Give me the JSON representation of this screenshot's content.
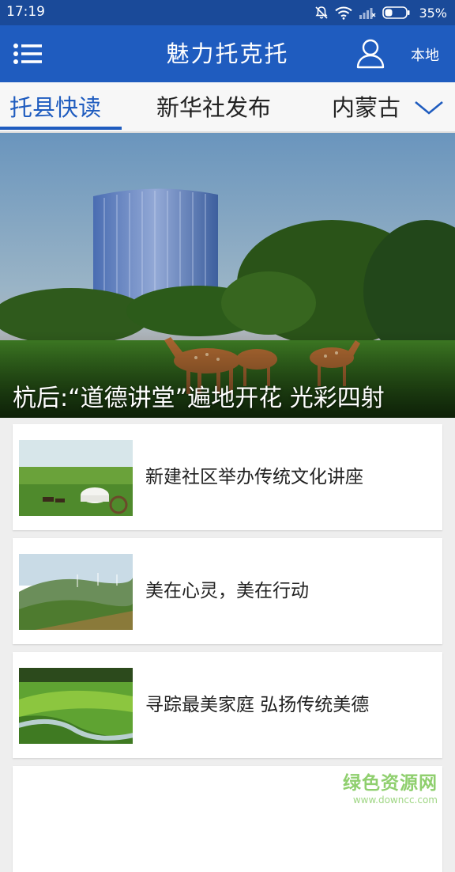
{
  "status_bar": {
    "time": "17:19",
    "battery": "35%"
  },
  "header": {
    "title": "魅力托克托",
    "local_label": "本地"
  },
  "tabs": [
    {
      "label": "托县快读",
      "active": true
    },
    {
      "label": "新华社发布",
      "active": false
    },
    {
      "label": "内蒙古",
      "active": false
    }
  ],
  "hero": {
    "caption": "杭后:“道德讲堂”遍地开花 光彩四射"
  },
  "news": [
    {
      "title": "新建社区举办传统文化讲座",
      "thumb": "grassland-yurt-horses"
    },
    {
      "title": "美在心灵，美在行动",
      "thumb": "hills-wind-turbines"
    },
    {
      "title": "寻踪最美家庭 弘扬传统美德",
      "thumb": "river-wetland"
    },
    {
      "title": "",
      "thumb": ""
    }
  ],
  "watermark": {
    "main": "绿色资源网",
    "url": "www.downcc.com"
  },
  "colors": {
    "header": "#1f5cbf",
    "status_bar": "#1a4a99",
    "accent": "#1f5cbf"
  },
  "icons": [
    "mute-icon",
    "wifi-icon",
    "signal-icon",
    "battery-icon",
    "menu-icon",
    "user-icon",
    "chevron-down-icon"
  ]
}
